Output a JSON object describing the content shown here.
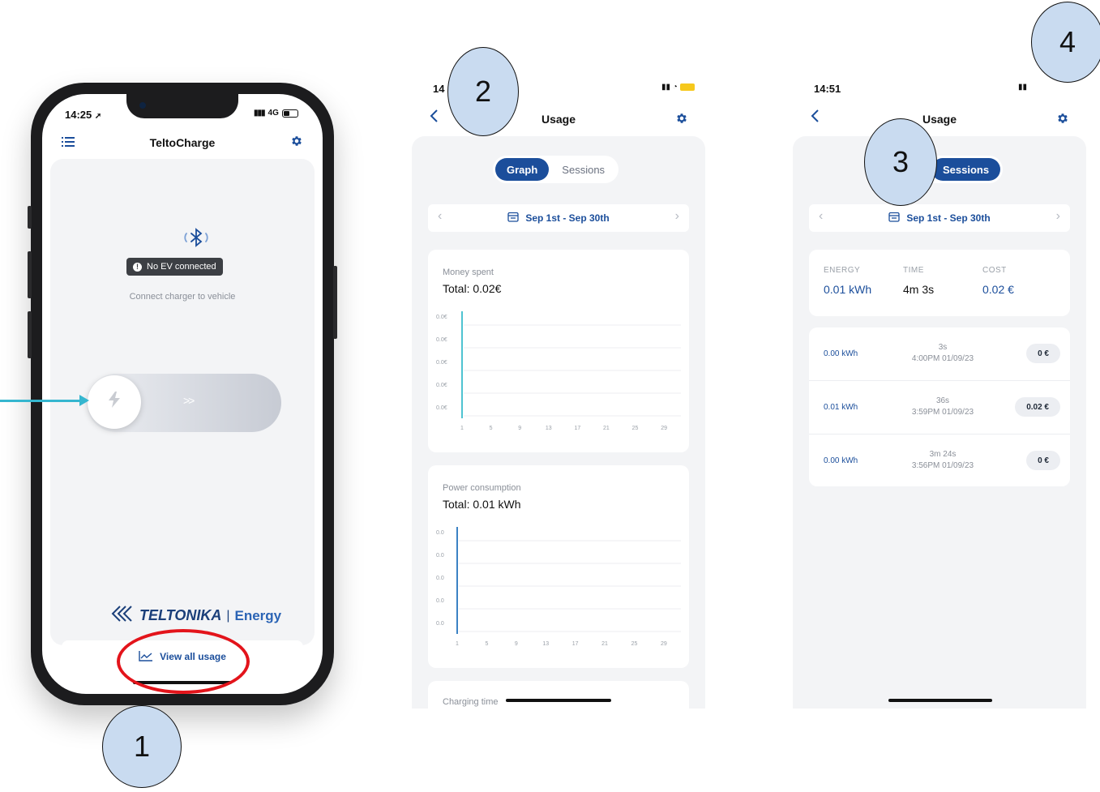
{
  "colors": {
    "accent": "#1b4e9b",
    "callout_fill": "#c9dbf0",
    "arrow": "#35b6cf",
    "highlight_ring": "#e3141b"
  },
  "callouts": {
    "c1": "1",
    "c2": "2",
    "c3": "3",
    "c4": "4"
  },
  "phone1": {
    "status_time": "14:25",
    "status_network": "4G",
    "title": "TeltoCharge",
    "ev_status": "No EV connected",
    "instruction": "Connect charger to vehicle",
    "slider_chevrons": ">>",
    "brand_name": "TELTONIKA",
    "brand_separator": "|",
    "brand_suffix": "Energy",
    "view_usage_label": "View all usage",
    "icons": [
      "menu-icon",
      "settings-icon",
      "bluetooth-icon",
      "lightning-icon",
      "chart-line-icon"
    ]
  },
  "screen2": {
    "status_time_partial": "14",
    "title": "Usage",
    "tabs": [
      "Graph",
      "Sessions"
    ],
    "active_tab": "Graph",
    "date_range": "Sep 1st - Sep 30th",
    "money_card": {
      "label": "Money spent",
      "total": "Total: 0.02€"
    },
    "power_card": {
      "label": "Power consumption",
      "total": "Total: 0.01 kWh"
    },
    "charging_card": {
      "label": "Charging time"
    }
  },
  "chart_data": [
    {
      "type": "bar",
      "title": "Money spent",
      "subtitle": "Total: 0.02€",
      "x": [
        1,
        5,
        9,
        13,
        17,
        21,
        25,
        29
      ],
      "yticks": [
        "0.0€",
        "0.0€",
        "0.0€",
        "0.0€",
        "0.0€"
      ],
      "series": [
        {
          "values": [
            {
              "x": 1,
              "y": 0.02
            }
          ],
          "color": "#4fc3d1"
        }
      ],
      "xlim": [
        1,
        30
      ],
      "grid": true
    },
    {
      "type": "bar",
      "title": "Power consumption",
      "subtitle": "Total: 0.01 kWh",
      "x": [
        1,
        5,
        9,
        13,
        17,
        21,
        25,
        29
      ],
      "yticks": [
        "0.0",
        "0.0",
        "0.0",
        "0.0",
        "0.0"
      ],
      "series": [
        {
          "values": [
            {
              "x": 1,
              "y": 0.01
            }
          ],
          "color": "#3b82c4"
        }
      ],
      "xlim": [
        1,
        30
      ],
      "grid": true
    }
  ],
  "screen3": {
    "status_time": "14:51",
    "title": "Usage",
    "active_tab": "Sessions",
    "date_range": "Sep 1st - Sep 30th",
    "summary": [
      {
        "heading": "ENERGY",
        "value": "0.01 kWh"
      },
      {
        "heading": "TIME",
        "value": "4m 3s"
      },
      {
        "heading": "COST",
        "value": "0.02 €"
      }
    ],
    "sessions": [
      {
        "energy": "0.00 kWh",
        "duration": "3s",
        "datetime": "4:00PM 01/09/23",
        "cost": "0 €"
      },
      {
        "energy": "0.01 kWh",
        "duration": "36s",
        "datetime": "3:59PM 01/09/23",
        "cost": "0.02 €"
      },
      {
        "energy": "0.00 kWh",
        "duration": "3m 24s",
        "datetime": "3:56PM 01/09/23",
        "cost": "0 €"
      }
    ]
  }
}
